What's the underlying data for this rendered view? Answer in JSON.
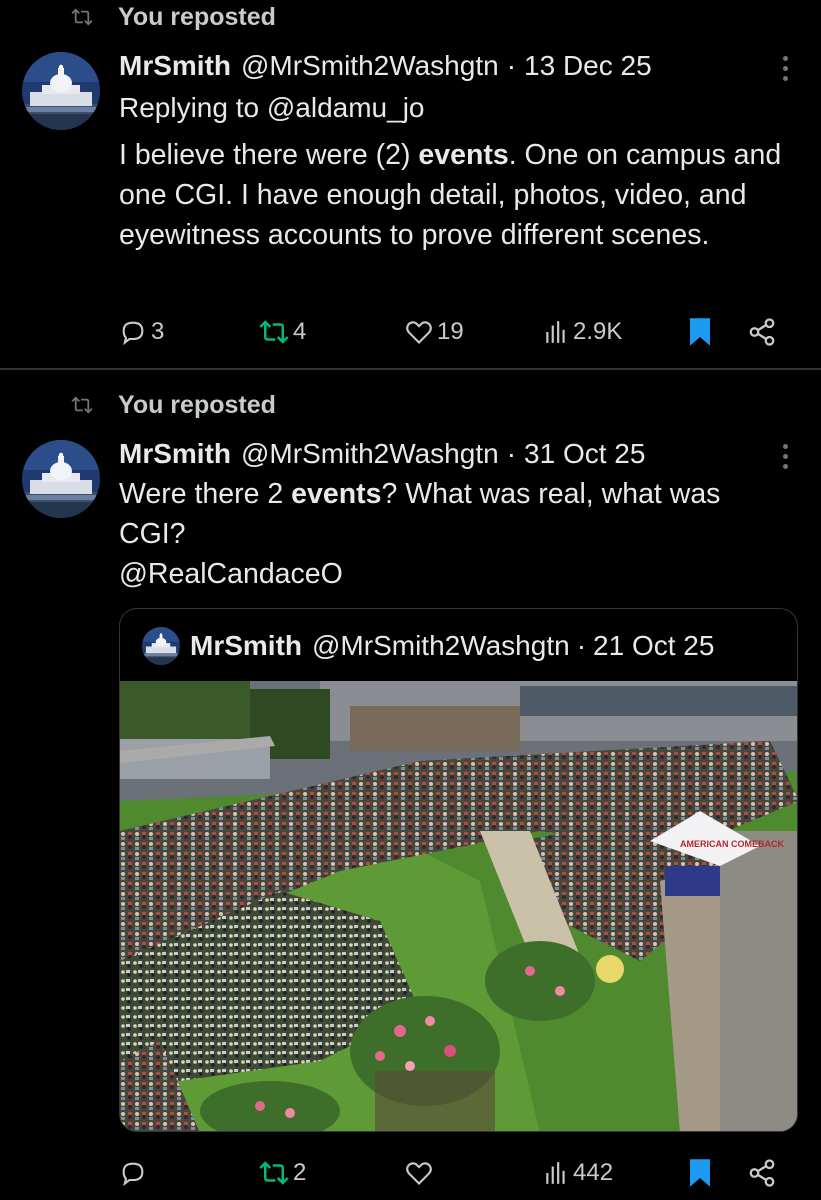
{
  "posts": [
    {
      "repost_label": "You reposted",
      "author_name": "MrSmith",
      "author_handle": "@MrSmith2Washgtn",
      "separator": "·",
      "date": "13 Dec 25",
      "replying_to": "Replying to @aldamu_jo",
      "text_parts": [
        "I believe there were (2) ",
        "events",
        ". One on campus and one CGI. I have enough detail, photos, video, and eyewitness accounts to prove different scenes."
      ],
      "metrics": {
        "replies": "3",
        "reposts": "4",
        "likes": "19",
        "views": "2.9K"
      }
    },
    {
      "repost_label": "You reposted",
      "author_name": "MrSmith",
      "author_handle": "@MrSmith2Washgtn",
      "separator": "·",
      "date": "31 Oct 25",
      "text_parts": [
        "Were there 2 ",
        "events",
        "? What was real, what was CGI?"
      ],
      "mention_line": "@RealCandaceO",
      "quote": {
        "author_name": "MrSmith",
        "author_handle": "@MrSmith2Washgtn",
        "separator": "·",
        "date": "21 Oct 25",
        "tent_text": "AMERICAN COMEBACK"
      },
      "metrics": {
        "replies": "",
        "reposts": "2",
        "likes": "",
        "views": "442"
      }
    }
  ],
  "colors": {
    "background": "#000000",
    "text": "#e7e9ea",
    "muted": "#71767b",
    "repost_green": "#00ba7c",
    "bookmark_blue": "#1d9bf0",
    "border": "#2f3336"
  },
  "icons": {
    "repost": "repost-icon",
    "reply": "reply-icon",
    "like": "heart-icon",
    "views": "views-icon",
    "bookmark": "bookmark-icon",
    "share": "share-icon",
    "more": "more-icon"
  }
}
